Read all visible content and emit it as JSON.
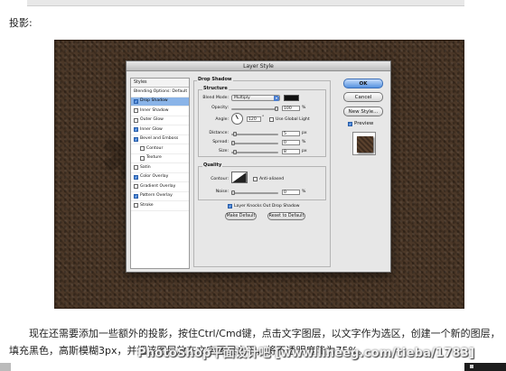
{
  "section": {
    "label": "投影:"
  },
  "dialog": {
    "title": "Layer Style",
    "styles_header": "Styles",
    "style_items": [
      {
        "label": "Blending Options: Default",
        "checkbox": false,
        "checked": false,
        "selected": false,
        "indent": false
      },
      {
        "label": "Drop Shadow",
        "checkbox": true,
        "checked": true,
        "selected": true,
        "indent": false
      },
      {
        "label": "Inner Shadow",
        "checkbox": true,
        "checked": false,
        "selected": false,
        "indent": false
      },
      {
        "label": "Outer Glow",
        "checkbox": true,
        "checked": false,
        "selected": false,
        "indent": false
      },
      {
        "label": "Inner Glow",
        "checkbox": true,
        "checked": true,
        "selected": false,
        "indent": false
      },
      {
        "label": "Bevel and Emboss",
        "checkbox": true,
        "checked": true,
        "selected": false,
        "indent": false
      },
      {
        "label": "Contour",
        "checkbox": true,
        "checked": false,
        "selected": false,
        "indent": true
      },
      {
        "label": "Texture",
        "checkbox": true,
        "checked": false,
        "selected": false,
        "indent": true
      },
      {
        "label": "Satin",
        "checkbox": true,
        "checked": false,
        "selected": false,
        "indent": false
      },
      {
        "label": "Color Overlay",
        "checkbox": true,
        "checked": true,
        "selected": false,
        "indent": false
      },
      {
        "label": "Gradient Overlay",
        "checkbox": true,
        "checked": false,
        "selected": false,
        "indent": false
      },
      {
        "label": "Pattern Overlay",
        "checkbox": true,
        "checked": true,
        "selected": false,
        "indent": false
      },
      {
        "label": "Stroke",
        "checkbox": true,
        "checked": false,
        "selected": false,
        "indent": false
      }
    ],
    "drop_shadow": {
      "title": "Drop Shadow",
      "structure_label": "Structure",
      "blend_mode_label": "Blend Mode:",
      "blend_mode_value": "Multiply",
      "shadow_color": "#111111",
      "opacity_label": "Opacity:",
      "opacity_value": "100",
      "opacity_unit": "%",
      "opacity_level": 1.0,
      "angle_label": "Angle:",
      "angle_value": "120",
      "angle_unit": "°",
      "use_global_light_label": "Use Global Light",
      "distance_label": "Distance:",
      "distance_value": "5",
      "distance_unit": "px",
      "distance_level": 0.05,
      "spread_label": "Spread:",
      "spread_value": "0",
      "spread_unit": "%",
      "spread_level": 0.0,
      "size_label": "Size:",
      "size_value": "8",
      "size_unit": "px",
      "size_level": 0.04,
      "quality_label": "Quality",
      "contour_label": "Contour:",
      "anti_aliased_label": "Anti-aliased",
      "noise_label": "Noise:",
      "noise_value": "0",
      "noise_unit": "%",
      "noise_level": 0.0,
      "knocks_out_label": "Layer Knocks Out Drop Shadow",
      "make_default_label": "Make Default",
      "reset_default_label": "Reset to Default"
    },
    "buttons": {
      "ok": "OK",
      "cancel": "Cancel",
      "new_style": "New Style..."
    },
    "preview_label": "Preview"
  },
  "paragraph": "现在还需要添加一些额外的投影，按住Ctrl/Cmd键，点击文字图层，以文字作为选区，创建一个新的图层，填充黑色，高斯模糊3px，并把该图层放在文字图层之下，将不透明度降为75%。",
  "watermark": "PhotoShop平面设计吧 [www.lineeg.com/tieba/1783]",
  "colors": {
    "accent": "#5592e0",
    "selected_row": "#8ab4e8",
    "background_texture": "#443222"
  }
}
